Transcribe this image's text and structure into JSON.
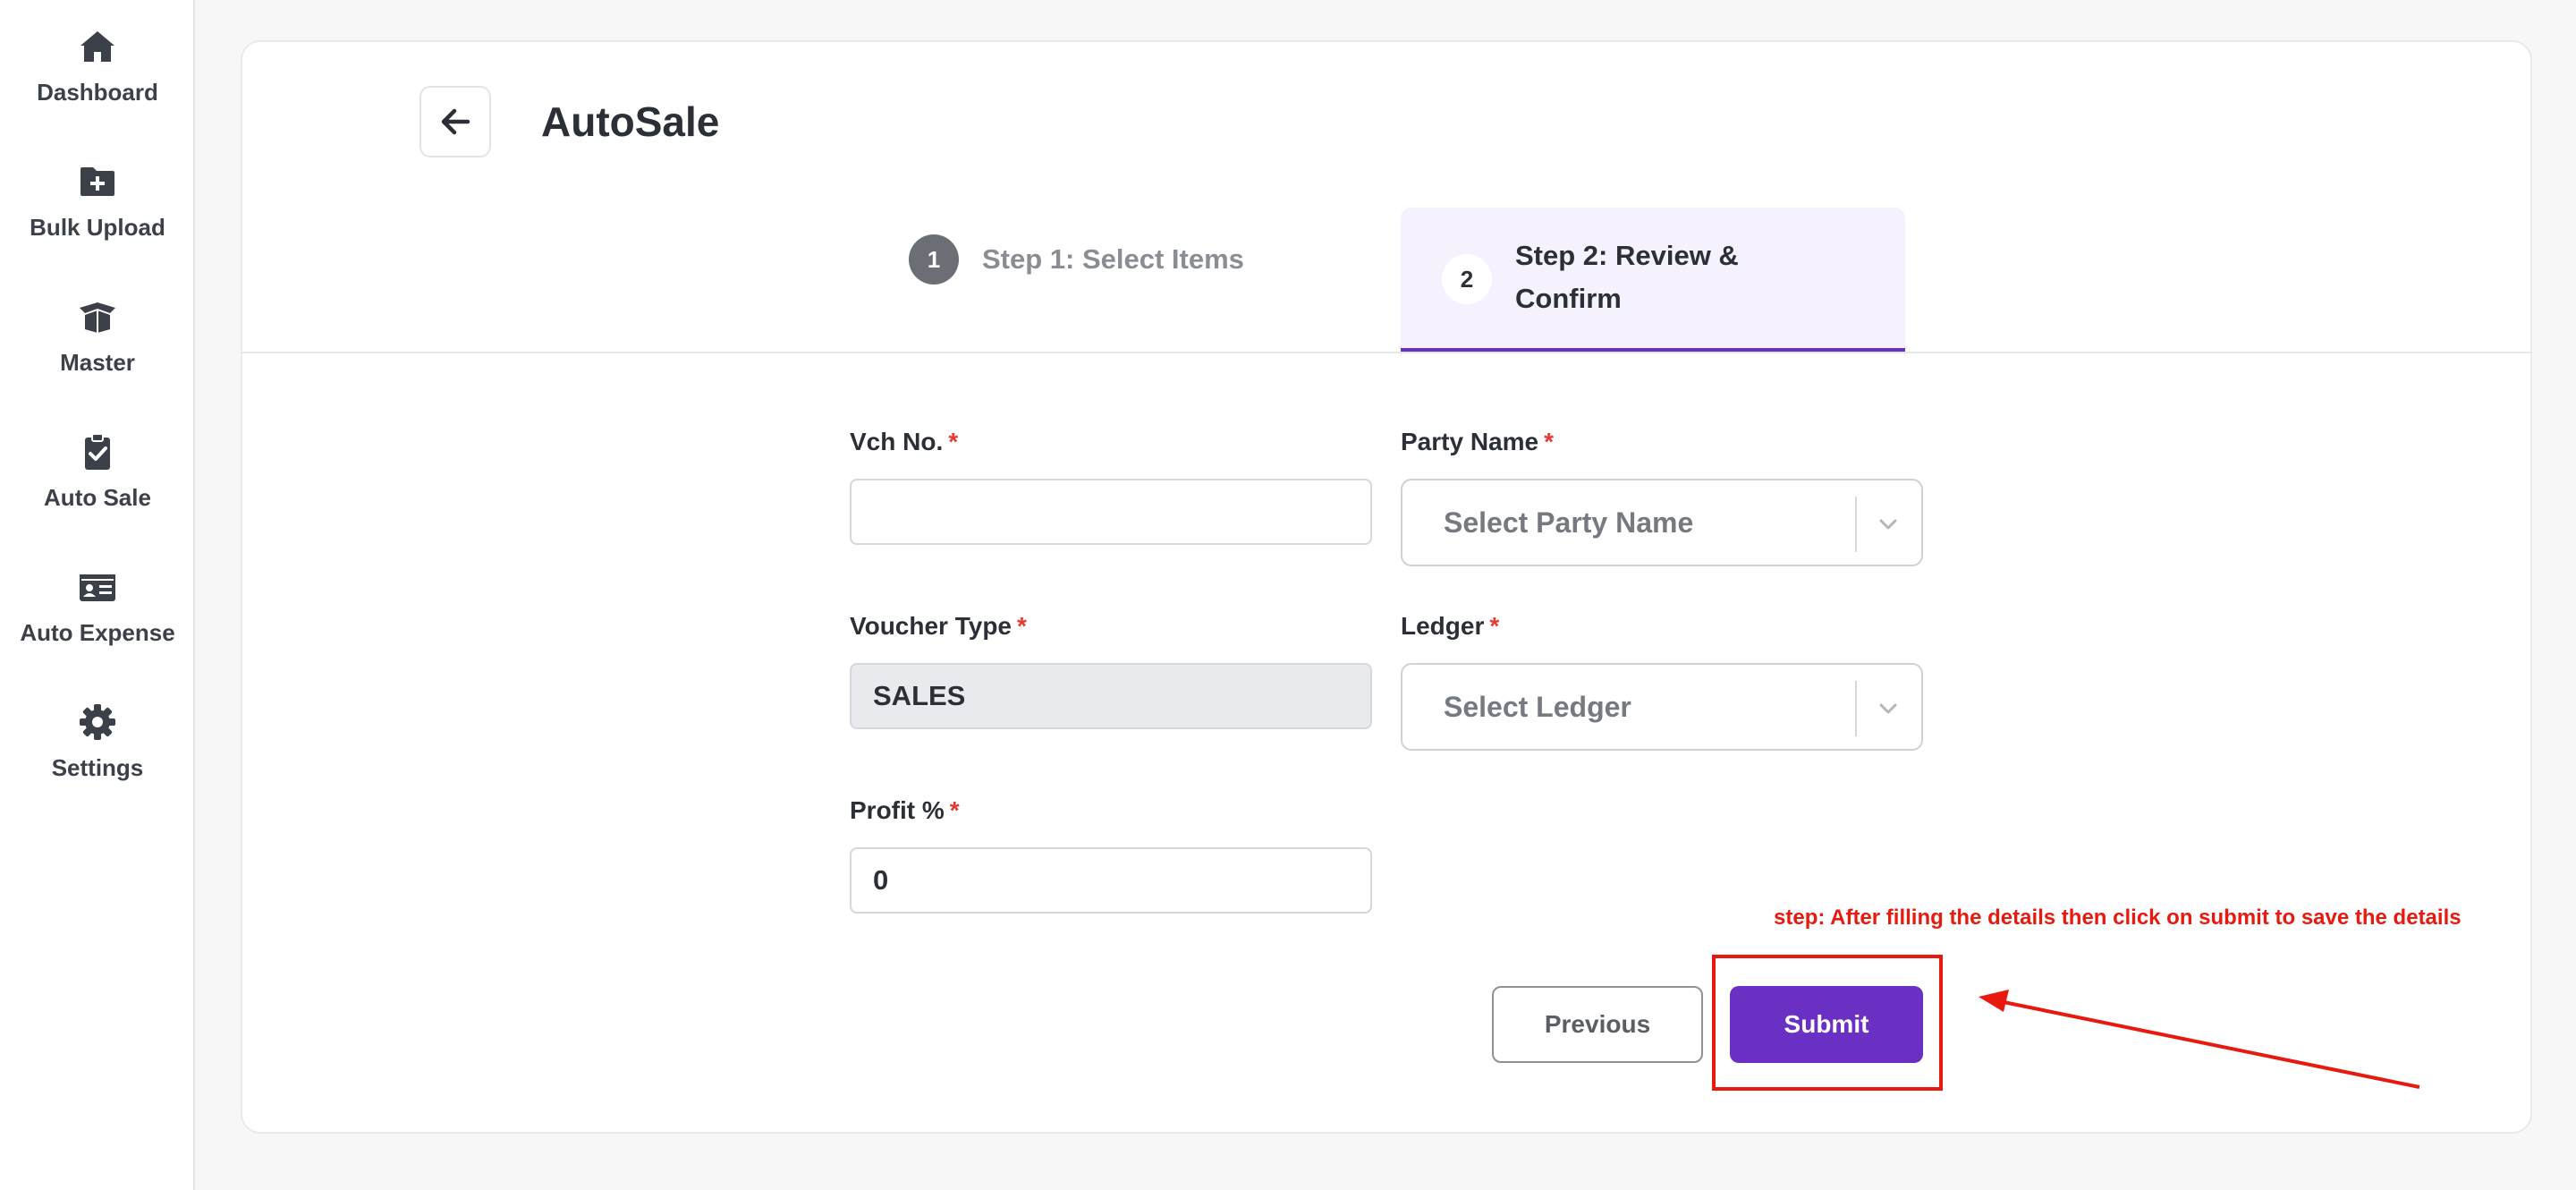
{
  "sidebar": {
    "items": [
      {
        "label": "Dashboard",
        "icon": "home-icon"
      },
      {
        "label": "Bulk Upload",
        "icon": "folder-plus-icon"
      },
      {
        "label": "Master",
        "icon": "box-open-icon"
      },
      {
        "label": "Auto Sale",
        "icon": "clipboard-check-icon"
      },
      {
        "label": "Auto Expense",
        "icon": "id-card-icon"
      },
      {
        "label": "Settings",
        "icon": "gear-icon"
      }
    ]
  },
  "header": {
    "title": "AutoSale",
    "back_icon": "arrow-left-icon"
  },
  "steps": [
    {
      "number": "1",
      "label": "Step 1: Select Items",
      "active": false
    },
    {
      "number": "2",
      "label": "Step 2: Review & Confirm",
      "active": true
    }
  ],
  "form": {
    "vch_no": {
      "label": "Vch No.",
      "required_mark": "*",
      "value": ""
    },
    "party_name": {
      "label": "Party Name",
      "required_mark": "*",
      "placeholder": "Select Party Name"
    },
    "voucher_type": {
      "label": "Voucher Type",
      "required_mark": "*",
      "value": "SALES"
    },
    "ledger": {
      "label": "Ledger",
      "required_mark": "*",
      "placeholder": "Select Ledger"
    },
    "profit": {
      "label": "Profit %",
      "required_mark": "*",
      "value": "0"
    }
  },
  "actions": {
    "previous_label": "Previous",
    "submit_label": "Submit"
  },
  "annotation": {
    "text": "step: After filling the details then click on submit to save the details"
  },
  "colors": {
    "accent": "#6930c3",
    "annotation": "#e8190f",
    "required": "#e53935",
    "active_step_bg": "#f6f2fd"
  }
}
